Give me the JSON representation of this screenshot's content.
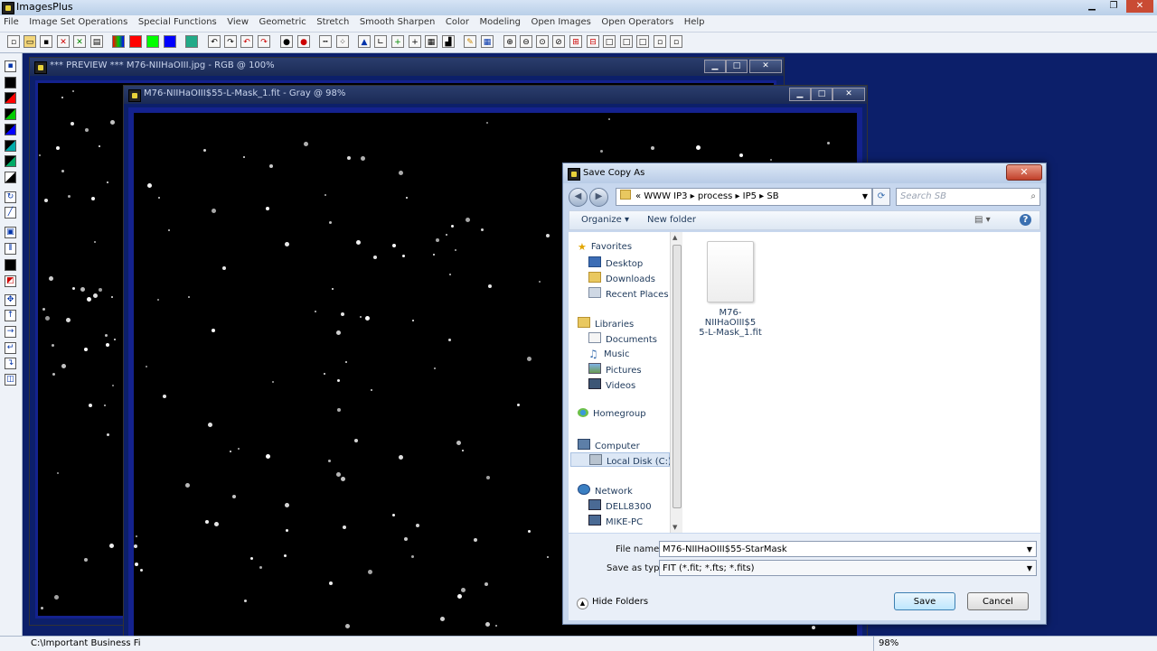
{
  "app": {
    "title": "ImagesPlus"
  },
  "menu": [
    "File",
    "Image Set Operations",
    "Special Functions",
    "View",
    "Geometric",
    "Stretch",
    "Smooth Sharpen",
    "Color",
    "Modeling",
    "Open Images",
    "Open Operators",
    "Help"
  ],
  "preview_window": {
    "title": "*** PREVIEW *** M76-NIIHaOIII.jpg - RGB @ 100%"
  },
  "mask_window": {
    "title": "M76-NIIHaOIII$55-L-Mask_1.fit - Gray @ 98%"
  },
  "dialog": {
    "title": "Save Copy As",
    "breadcrumb": "«  WWW IP3  ▸  process  ▸  IP5  ▸  SB",
    "search_placeholder": "Search SB",
    "organize": "Organize ▾",
    "new_folder": "New folder",
    "nav": {
      "favorites": "Favorites",
      "desktop": "Desktop",
      "downloads": "Downloads",
      "recent": "Recent Places",
      "libraries": "Libraries",
      "documents": "Documents",
      "music": "Music",
      "pictures": "Pictures",
      "videos": "Videos",
      "homegroup": "Homegroup",
      "computer": "Computer",
      "localdisk": "Local Disk (C:)",
      "network": "Network",
      "dell": "DELL8300",
      "mike": "MIKE-PC"
    },
    "file_name_line1": "M76-NIIHaOIII$5",
    "file_name_line2": "5-L-Mask_1.fit",
    "file_name_label": "File name:",
    "file_name_value": "M76-NIIHaOIII$55-StarMask",
    "save_type_label": "Save as type:",
    "save_type_value": "FIT (*.fit; *.fts; *.fits)",
    "hide_folders": "Hide Folders",
    "save": "Save",
    "cancel": "Cancel"
  },
  "status": {
    "path": "C:\\Important Business Fi",
    "zoom": "98%"
  }
}
